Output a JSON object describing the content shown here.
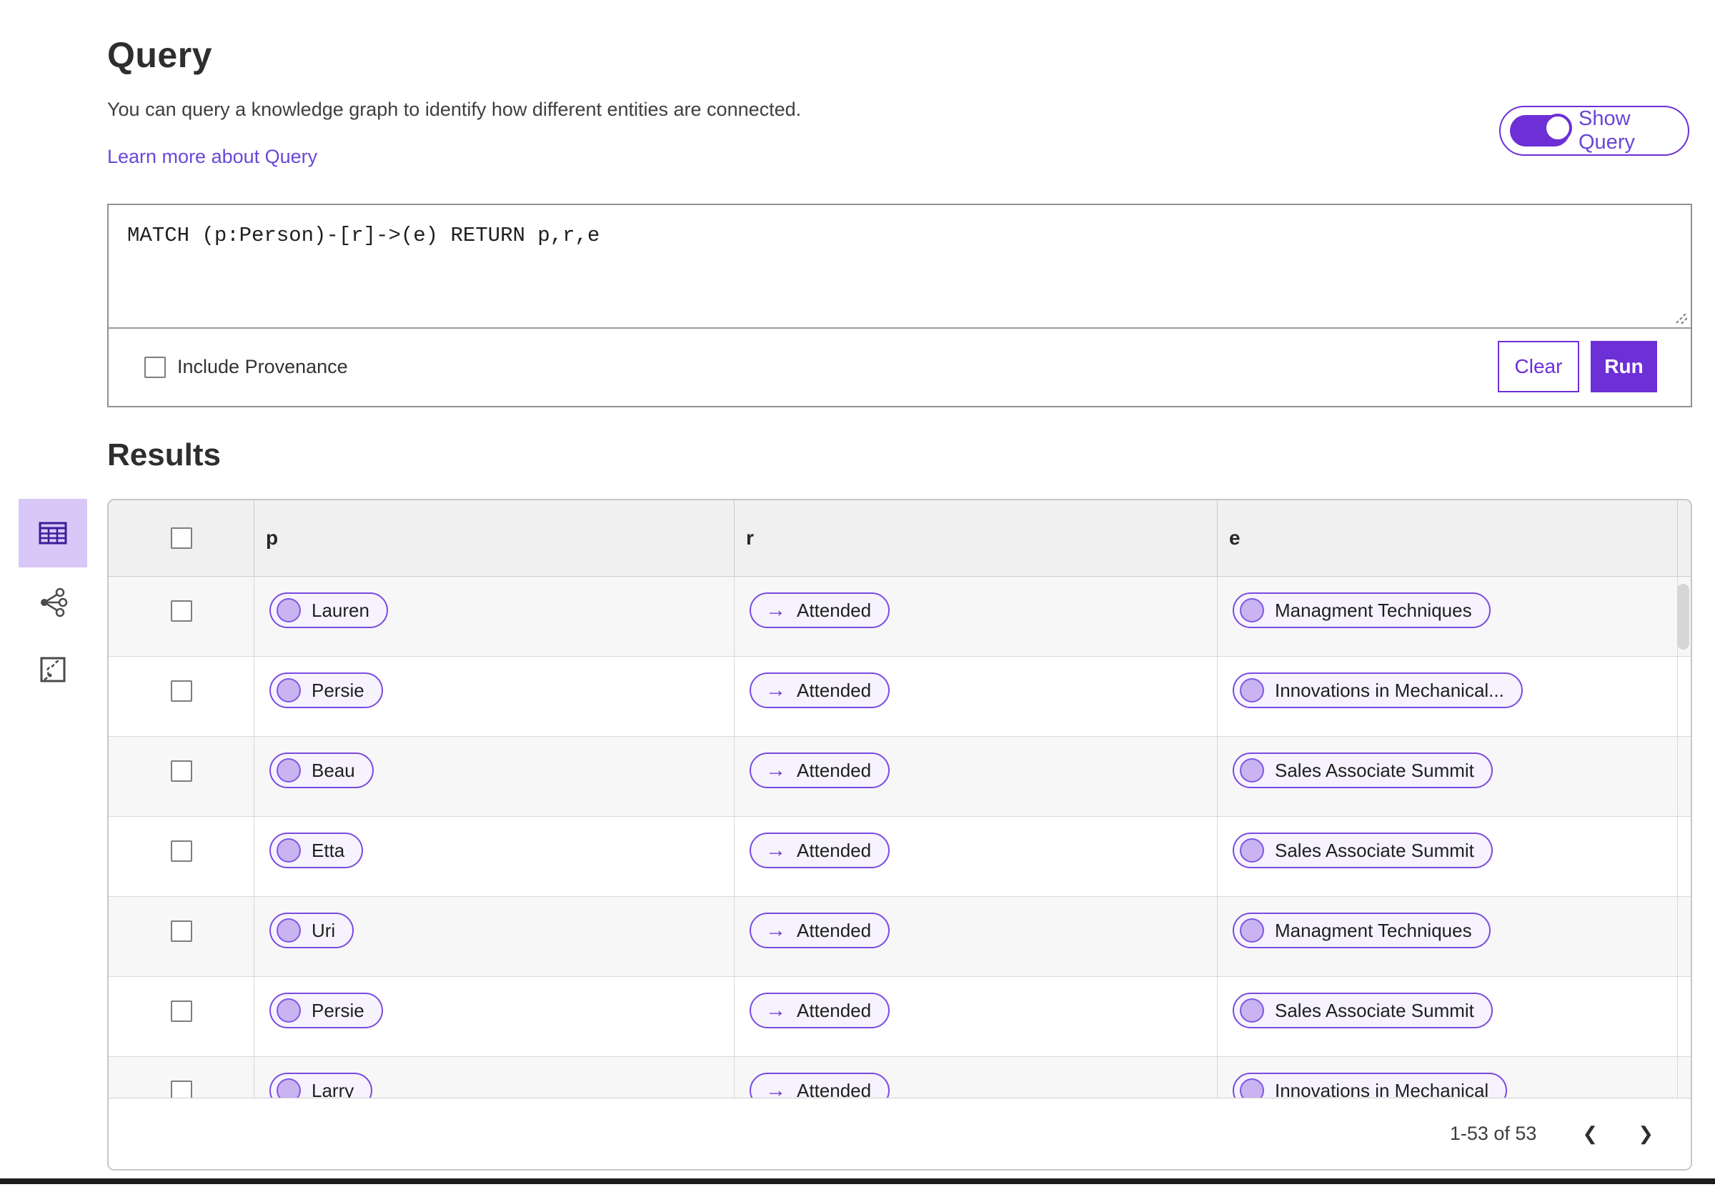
{
  "colors": {
    "accent_purple": "#6d2fd6",
    "pill_border": "#7a4be0",
    "pill_bg": "#f6f3fe",
    "pill_circle": "#c9b3f0",
    "selected_view_bg": "#d9c8f7",
    "header_bg": "#f0f0f0",
    "zebra_row_bg": "#f7f7f7",
    "link_color": "#6949d8"
  },
  "query_section": {
    "title": "Query",
    "description": "You can query a knowledge graph to identify how different entities are connected.",
    "learn_more_label": "Learn more about Query",
    "show_query_label": "Show Query",
    "show_query_state": "on",
    "query_text": "MATCH (p:Person)-[r]->(e) RETURN p,r,e",
    "include_provenance_label": "Include Provenance",
    "include_provenance_checked": false,
    "clear_label": "Clear",
    "run_label": "Run"
  },
  "results_section": {
    "title": "Results",
    "views": [
      {
        "name": "table-view",
        "selected": true
      },
      {
        "name": "graph-view",
        "selected": false
      },
      {
        "name": "map-view",
        "selected": false
      }
    ],
    "table": {
      "columns": [
        "p",
        "r",
        "e"
      ],
      "arrow": "→",
      "rows": [
        {
          "p": "Lauren",
          "r": "Attended",
          "e": "Managment Techniques"
        },
        {
          "p": "Persie",
          "r": "Attended",
          "e": "Innovations in Mechanical..."
        },
        {
          "p": "Beau",
          "r": "Attended",
          "e": "Sales Associate Summit"
        },
        {
          "p": "Etta",
          "r": "Attended",
          "e": "Sales Associate Summit"
        },
        {
          "p": "Uri",
          "r": "Attended",
          "e": "Managment Techniques"
        },
        {
          "p": "Persie",
          "r": "Attended",
          "e": "Sales Associate Summit"
        },
        {
          "p": "Larry",
          "r": "Attended",
          "e": "Innovations in Mechanical"
        }
      ]
    },
    "pagination": {
      "range_label": "1-53 of 53",
      "prev_icon": "❮",
      "next_icon": "❯"
    }
  }
}
